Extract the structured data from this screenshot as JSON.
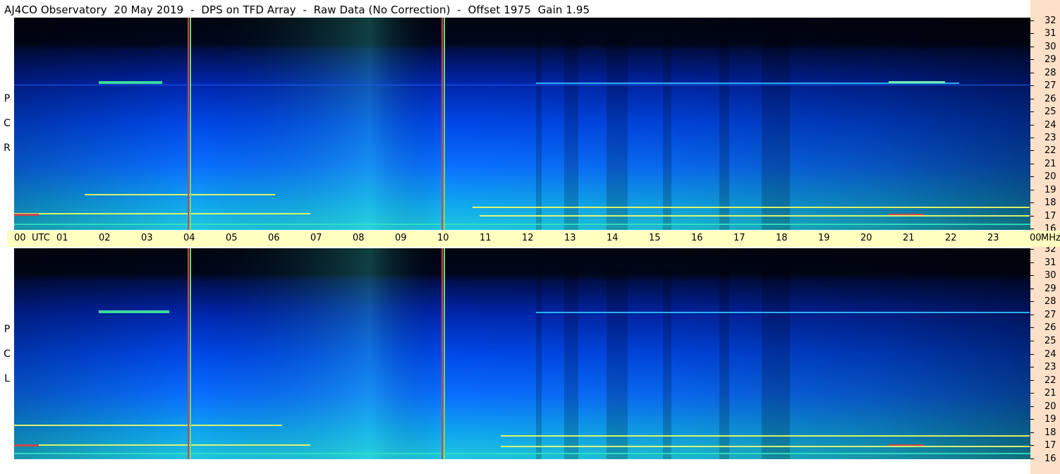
{
  "title": "AJ4CO Observatory  20 May 2019  -  DPS on TFD Array  -  Raw Data (No Correction)  -  Offset 1975  Gain 1.95",
  "panels": [
    {
      "id": "rcp",
      "side_label_letters": [
        "P",
        "C",
        "R"
      ]
    },
    {
      "id": "lcp",
      "side_label_letters": [
        "P",
        "C",
        "L"
      ]
    }
  ],
  "freq_axis": {
    "ticks_mhz": [
      "32",
      "31",
      "30",
      "29",
      "28",
      "27",
      "26",
      "25",
      "24",
      "23",
      "22",
      "21",
      "20",
      "19",
      "18",
      "17",
      "16"
    ]
  },
  "time_axis": {
    "labels": [
      "00",
      "UTC",
      "01",
      "02",
      "03",
      "04",
      "05",
      "06",
      "07",
      "08",
      "09",
      "10",
      "11",
      "12",
      "13",
      "14",
      "15",
      "16",
      "17",
      "18",
      "19",
      "20",
      "21",
      "22",
      "23",
      "00",
      "MHz"
    ]
  },
  "colors": {
    "spectrum_low": "#000818",
    "spectrum_mid": "#0a3cff",
    "spectrum_high": "#10e0c0",
    "signal": "#f0ff60",
    "interference_red": "#e04040",
    "interference_green": "#60e080",
    "time_bar_bg": "#ffffc0",
    "freq_scale_bg": "#fde0c8"
  }
}
